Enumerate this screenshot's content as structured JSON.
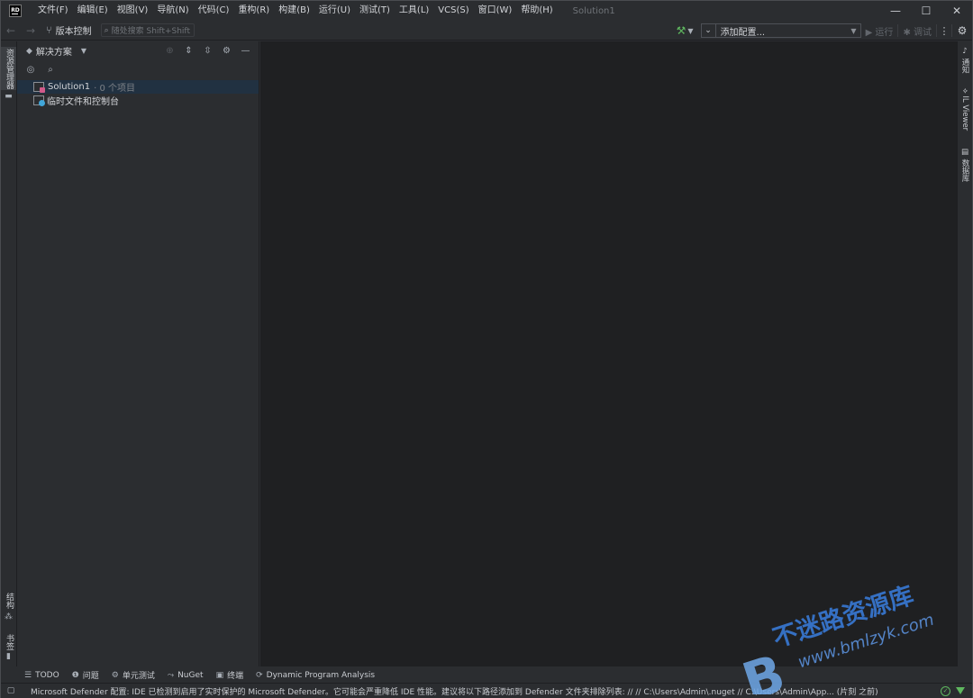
{
  "app": {
    "logo_text": "RD",
    "window_title": "Solution1",
    "menu": [
      "文件(F)",
      "编辑(E)",
      "视图(V)",
      "导航(N)",
      "代码(C)",
      "重构(R)",
      "构建(B)",
      "运行(U)",
      "测试(T)",
      "工具(L)",
      "VCS(S)",
      "窗口(W)",
      "帮助(H)"
    ],
    "window_controls": {
      "minimize": "—",
      "maximize": "☐",
      "close": "✕"
    }
  },
  "toolbar": {
    "back": "←",
    "forward": "→",
    "vcs_label": "版本控制",
    "search_placeholder": "随处搜索 Shift+Shift",
    "config_label": "添加配置...",
    "run_label": "▶ 运行",
    "debug_label": "调试",
    "more": "⋮",
    "settings": "⚙"
  },
  "left_stripe": {
    "explorer_tab": "资源管理器",
    "structure_tab": "结构",
    "bookmarks_tab": "书签"
  },
  "right_stripe": {
    "notifications": "通知",
    "il_viewer": "IL Viewer",
    "database": "数据库"
  },
  "explorer": {
    "title": "解决方案",
    "tree": [
      {
        "name": "Solution1",
        "detail": "· 0 个项目",
        "selected": true
      },
      {
        "name": "临时文件和控制台",
        "detail": "",
        "selected": false
      }
    ]
  },
  "bottom_tabs": [
    {
      "icon": "☰",
      "label": "TODO"
    },
    {
      "icon": "❶",
      "label": "问题"
    },
    {
      "icon": "⚙",
      "label": "单元测试"
    },
    {
      "icon": "⤳",
      "label": "NuGet"
    },
    {
      "icon": "▣",
      "label": "终端"
    },
    {
      "icon": "⟳",
      "label": "Dynamic Program Analysis"
    }
  ],
  "status": {
    "message": "Microsoft Defender 配置: IDE 已检测到启用了实时保护的 Microsoft Defender。它可能会严重降低 IDE 性能。建议将以下路径添加到 Defender 文件夹排除列表: // // C:\\Users\\Admin\\.nuget // C:\\Users\\Admin\\App... (片刻 之前)"
  },
  "watermark": {
    "cn": "不迷路资源库",
    "url": "www.bmlzyk.com",
    "letter": "B"
  },
  "colors": {
    "background": "#2b2d30",
    "editor": "#1f2022",
    "selection": "#213141",
    "accent_green": "#5fb85f",
    "watermark_blue": "#2f6fd6"
  }
}
